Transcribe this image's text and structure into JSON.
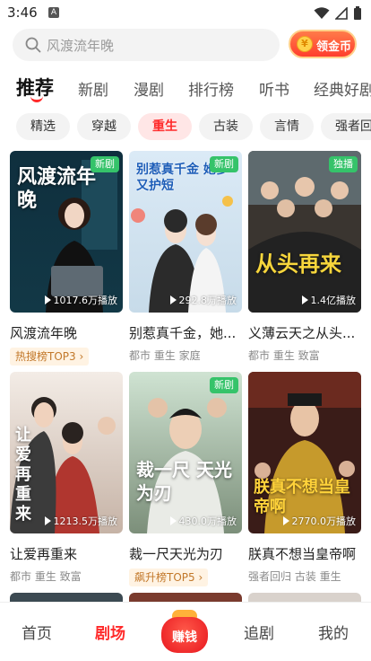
{
  "status_bar": {
    "time": "3:46",
    "notif_letter": "A"
  },
  "search": {
    "placeholder": "风渡流年晚",
    "coin_label": "领金币",
    "coin_icon": "¥"
  },
  "main_tabs": [
    "推荐",
    "新剧",
    "漫剧",
    "排行榜",
    "听书",
    "经典好剧"
  ],
  "chips": [
    "精选",
    "穿越",
    "重生",
    "古装",
    "言情",
    "强者回归"
  ],
  "cards": [
    {
      "title": "风渡流年晚",
      "plays": "1017.6万播放",
      "badge": "新剧",
      "rank": "热搜榜TOP3",
      "tags": "",
      "poster_text": "风渡流年晚"
    },
    {
      "title": "别惹真千金，她...",
      "plays": "292.8万播放",
      "badge": "新剧",
      "rank": "",
      "tags": "都市 重生 家庭",
      "poster_text": "别惹真千金 她爹又护短"
    },
    {
      "title": "义薄云天之从头...",
      "plays": "1.4亿播放",
      "badge": "独播",
      "rank": "",
      "tags": "都市 重生 致富",
      "poster_text": "从头再来"
    },
    {
      "title": "让爱再重来",
      "plays": "1213.5万播放",
      "badge": "",
      "rank": "",
      "tags": "都市 重生 致富",
      "poster_text": "让爱再重来"
    },
    {
      "title": "裁一尺天光为刃",
      "plays": "430.0万播放",
      "badge": "新剧",
      "rank": "飙升榜TOP5",
      "tags": "",
      "poster_text": "裁一尺 天光为刃"
    },
    {
      "title": "朕真不想当皇帝啊",
      "plays": "2770.0万播放",
      "badge": "",
      "rank": "",
      "tags": "强者回归 古装 重生",
      "poster_text": "朕真不想当皇帝啊"
    }
  ],
  "bottom_nav": {
    "home": "首页",
    "theater": "剧场",
    "earn": "赚钱",
    "follow": "追剧",
    "mine": "我的"
  },
  "colors": {
    "accent": "#ff2a2a",
    "new_badge": "#35c36a",
    "rank_tag_text": "#c2782a"
  }
}
